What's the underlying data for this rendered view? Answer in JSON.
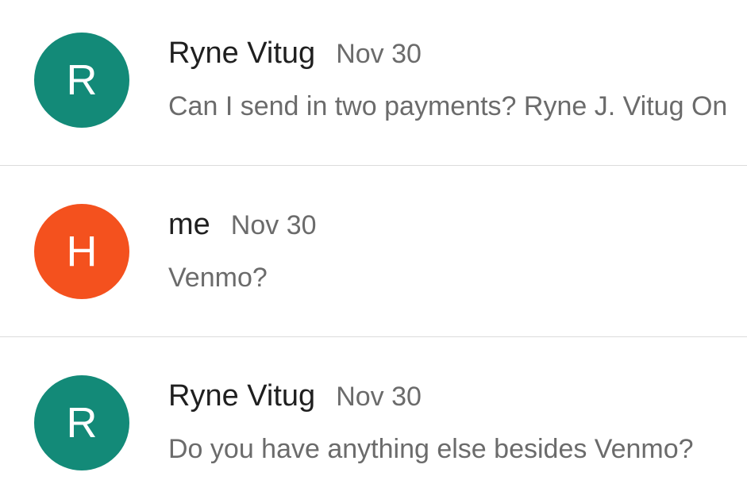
{
  "messages": [
    {
      "avatar_letter": "R",
      "avatar_color": "#138a78",
      "sender": "Ryne Vitug",
      "date": "Nov 30",
      "snippet": "Can I send in two payments? Ryne J. Vitug On"
    },
    {
      "avatar_letter": "H",
      "avatar_color": "#f4511e",
      "sender": "me",
      "date": "Nov 30",
      "snippet": "Venmo?"
    },
    {
      "avatar_letter": "R",
      "avatar_color": "#138a78",
      "sender": "Ryne Vitug",
      "date": "Nov 30",
      "snippet": "Do you have anything else besides Venmo?"
    }
  ]
}
